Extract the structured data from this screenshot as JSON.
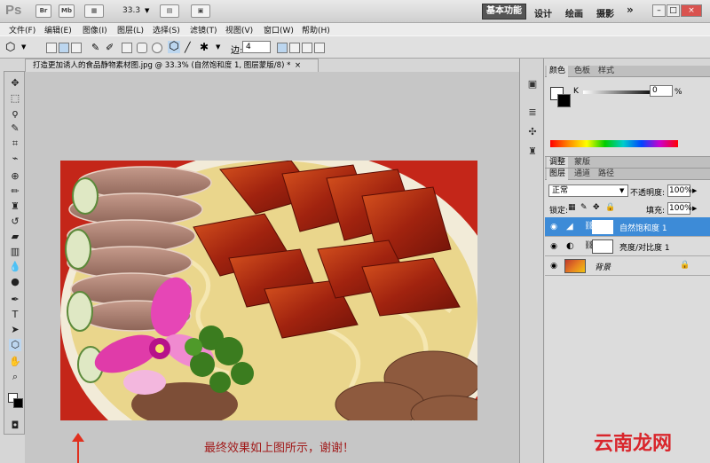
{
  "app": {
    "logo": "Ps",
    "zoom": "33.3",
    "br_label": "Br",
    "mb_label": "Mb"
  },
  "workspaces": {
    "active": "基本功能",
    "items": [
      "设计",
      "绘画",
      "摄影"
    ],
    "more": "»"
  },
  "menu": [
    "文件(F)",
    "编辑(E)",
    "图像(I)",
    "图层(L)",
    "选择(S)",
    "滤镜(T)",
    "视图(V)",
    "窗口(W)",
    "帮助(H)"
  ],
  "options": {
    "edge_label": "边:",
    "edge_value": "4"
  },
  "document": {
    "tab_title": "打造更加诱人的食品静物素材图.jpg @ 33.3% (自然饱和度 1, 图层蒙版/8) *",
    "close": "×"
  },
  "caption": "最终效果如上图所示，谢谢！",
  "color_panel": {
    "tabs": [
      "颜色",
      "色板",
      "样式"
    ],
    "channel": "K",
    "value": "0",
    "unit": "%"
  },
  "adjust_panel": {
    "tabs": [
      "调整",
      "蒙版"
    ]
  },
  "layers_panel": {
    "tabs": [
      "图层",
      "通道",
      "路径"
    ],
    "blend_mode": "正常",
    "opacity_label": "不透明度:",
    "opacity": "100%",
    "lock_label": "锁定:",
    "fill_label": "填充:",
    "fill": "100%",
    "layers": [
      {
        "name": "自然饱和度 1",
        "selected": true
      },
      {
        "name": "亮度/对比度 1",
        "selected": false
      },
      {
        "name": "背景",
        "selected": false
      }
    ]
  },
  "watermark": "云南龙网",
  "colors": {
    "accent": "#3d8bd7",
    "caption": "#a11a1a",
    "arrow": "#e0301e",
    "watermark": "#d9262c"
  }
}
